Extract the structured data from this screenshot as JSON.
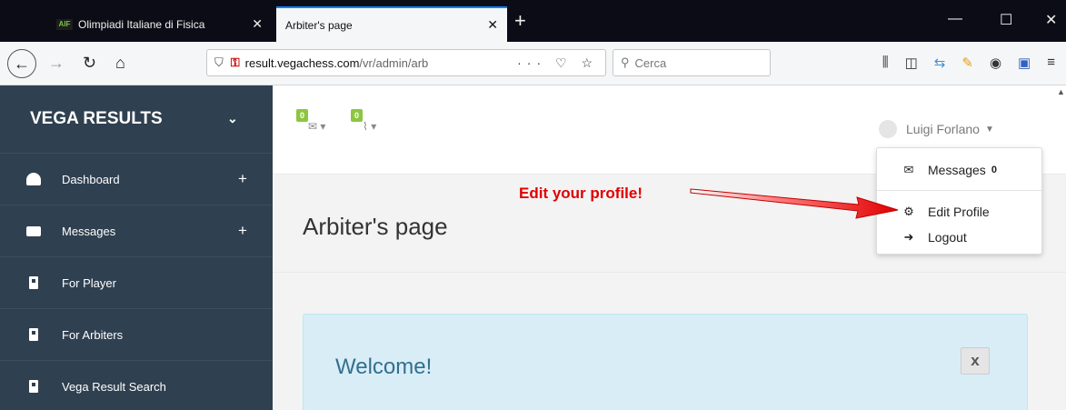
{
  "browser": {
    "tabs": [
      {
        "favicon": "AIF",
        "title": "Olimpiadi Italiane di Fisica",
        "close": "✕"
      },
      {
        "title": "Arbiter's page",
        "close": "✕"
      }
    ],
    "new_tab": "+",
    "window_controls": {
      "minimize": "—",
      "maximize": "☐",
      "close": "✕"
    },
    "url_host": "result.vegachess.com",
    "url_path": "/vr/admin/arb",
    "url_icons": "··· ♡ ☆",
    "search_placeholder": "Cerca"
  },
  "sidebar": {
    "brand": "VEGA RESULTS",
    "items": [
      {
        "label": "Dashboard",
        "icon": "dashboard-icon",
        "expand": "+"
      },
      {
        "label": "Messages",
        "icon": "inbox-icon",
        "expand": "+"
      },
      {
        "label": "For Player",
        "icon": "id-badge-icon"
      },
      {
        "label": "For Arbiters",
        "icon": "id-badge-icon"
      },
      {
        "label": "Vega Result Search",
        "icon": "id-badge-icon"
      }
    ]
  },
  "topbar": {
    "messages_count": "0",
    "attachments_count": "0",
    "user_name": "Luigi Forlano"
  },
  "user_menu": {
    "messages_label": "Messages",
    "messages_count": "0",
    "edit_profile_label": "Edit Profile",
    "logout_label": "Logout"
  },
  "page": {
    "title": "Arbiter's page",
    "welcome_title": "Welcome!",
    "welcome_close": "x"
  },
  "annotation": {
    "text": "Edit your profile!",
    "color": "#e00000"
  },
  "colors": {
    "sidebar_bg": "#2f4050",
    "badge_green": "#8cc63f",
    "welcome_bg": "#d9edf7"
  }
}
